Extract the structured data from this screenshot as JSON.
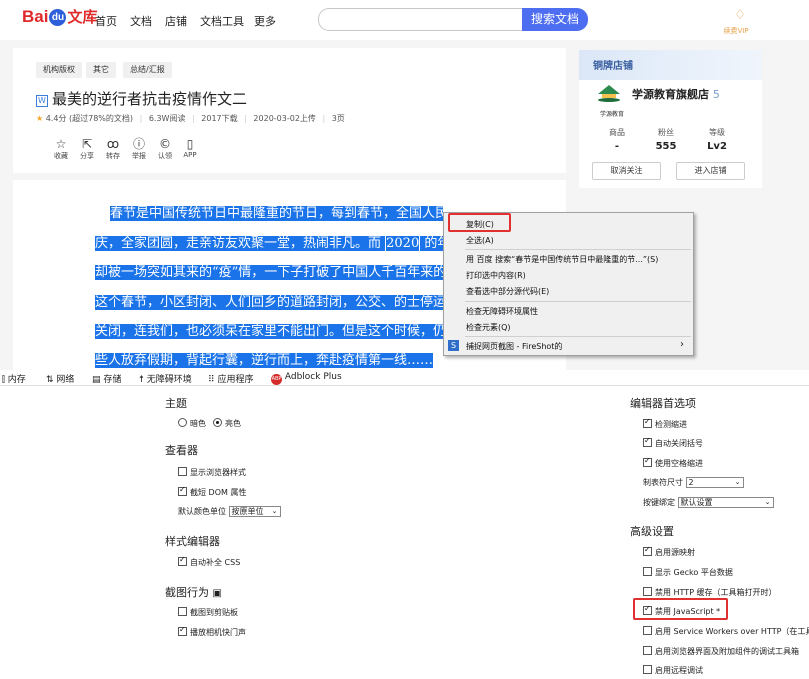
{
  "topbar": {
    "logo_bai": "Bai",
    "logo_du": "du",
    "logo_wenku": "文库",
    "nav": [
      "首页",
      "文档",
      "店铺",
      "文档工具",
      "更多"
    ],
    "search_button": "搜索文档",
    "vip_label": "续费VIP",
    "vip_icon": "diamond-icon"
  },
  "document": {
    "tags": [
      "机构版权",
      "其它",
      "总结/汇报"
    ],
    "title": "最美的逆行者抗击疫情作文二",
    "file_icon_letter": "W",
    "rating": "4.4分",
    "rating_note": "(超过78%的文档)",
    "reads": "6.3W阅读",
    "downloads": "2017下载",
    "upload_date": "2020-03-02上传",
    "pages": "3页",
    "actions": [
      {
        "icon": "star-icon",
        "label": "收藏"
      },
      {
        "icon": "share-icon",
        "label": "分享"
      },
      {
        "icon": "forward-icon",
        "label": "转存"
      },
      {
        "icon": "report-icon",
        "label": "举报"
      },
      {
        "icon": "copyright-icon",
        "label": "认领"
      },
      {
        "icon": "phone-icon",
        "label": "APP"
      }
    ],
    "lines": [
      {
        "pre": "春节是中国传统节日中最隆重的节日，每到春节，全国人民举国欢",
        "year": "",
        "post": ""
      },
      {
        "pre": "庆，全家团圆，走亲访友欢聚一堂，热闹非凡。而 ",
        "year": "2020",
        "post": " 的年"
      },
      {
        "pre": "却被一场突如其来的“疫”情，一下子打破了中国人千百年来的",
        "year": "",
        "post": ""
      },
      {
        "pre": "这个春节，小区封闭、人们回乡的道路封闭，公交、的士停运",
        "year": "",
        "post": ""
      },
      {
        "pre": "关闭，连我们，也必须呆在家里不能出门。但是这个时候，仍",
        "year": "",
        "post": ""
      },
      {
        "pre": "些人放弃假期，背起行囊，逆行而上，奔赴疫情第一线……",
        "year": "",
        "post": ""
      }
    ]
  },
  "shop": {
    "header": "铜牌店铺",
    "name": "学源教育旗舰店",
    "level_badge": "5",
    "sub_logo_text": "学源教育",
    "stats": [
      {
        "label": "商品",
        "value": "-"
      },
      {
        "label": "粉丝",
        "value": "555"
      },
      {
        "label": "等级",
        "value": "Lv2"
      }
    ],
    "unfollow_button": "取消关注",
    "enter_button": "进入店铺"
  },
  "context_menu": {
    "items": [
      {
        "label": "复制(C)"
      },
      {
        "label": "全选(A)"
      },
      {
        "label": "用 百度 搜索“春节是中国传统节日中最隆重的节...”(S)"
      },
      {
        "label": "打印选中内容(R)"
      },
      {
        "label": "查看选中部分源代码(E)"
      },
      {
        "label": "检查无障碍环境属性"
      },
      {
        "label": "检查元素(Q)"
      },
      {
        "label": "捕捉网页截图 - FireShot的"
      }
    ],
    "submenu_arrow": "›"
  },
  "devtools_tabs": [
    {
      "icon": "memory-icon",
      "label": "内存"
    },
    {
      "icon": "network-icon",
      "label": "网络"
    },
    {
      "icon": "storage-icon",
      "label": "存储"
    },
    {
      "icon": "accessibility-icon",
      "label": "无障碍环境"
    },
    {
      "icon": "application-icon",
      "label": "应用程序"
    },
    {
      "icon": "adblock-icon",
      "label": "Adblock Plus"
    }
  ],
  "settings": {
    "theme": {
      "heading": "主题",
      "dark": "暗色",
      "light": "亮色",
      "selected": "亮色"
    },
    "inspector": {
      "heading": "查看器",
      "show_browser_styles": "显示浏览器样式",
      "truncate_dom": "截短 DOM 属性",
      "default_color_unit_label": "默认颜色单位",
      "default_color_unit_value": "按原单位"
    },
    "style_editor": {
      "heading": "样式编辑器",
      "autocomplete_css": "自动补全 CSS"
    },
    "screenshot": {
      "heading": "截图行为",
      "to_clipboard": "截图到剪贴板",
      "shutter_sound": "播放相机快门声"
    },
    "editor_prefs": {
      "heading": "编辑器首选项",
      "detect_indent": "检测缩进",
      "auto_close_brackets": "自动关闭括号",
      "use_spaces": "使用空格缩进",
      "tab_size_label": "制表符尺寸",
      "tab_size_value": "2",
      "keybinding_label": "按键绑定",
      "keybinding_value": "默认设置"
    },
    "advanced": {
      "heading": "高级设置",
      "source_maps": "启用源映射",
      "gecko_data": "显示 Gecko 平台数据",
      "disable_http_cache": "禁用 HTTP 缓存（工具箱打开时）",
      "disable_js": "禁用 JavaScript *",
      "service_workers": "启用 Service Workers over HTTP（在工具",
      "chrome_debug": "启用浏览器界面及附加组件的调试工具箱",
      "remote_debug": "启用远程调试"
    }
  }
}
